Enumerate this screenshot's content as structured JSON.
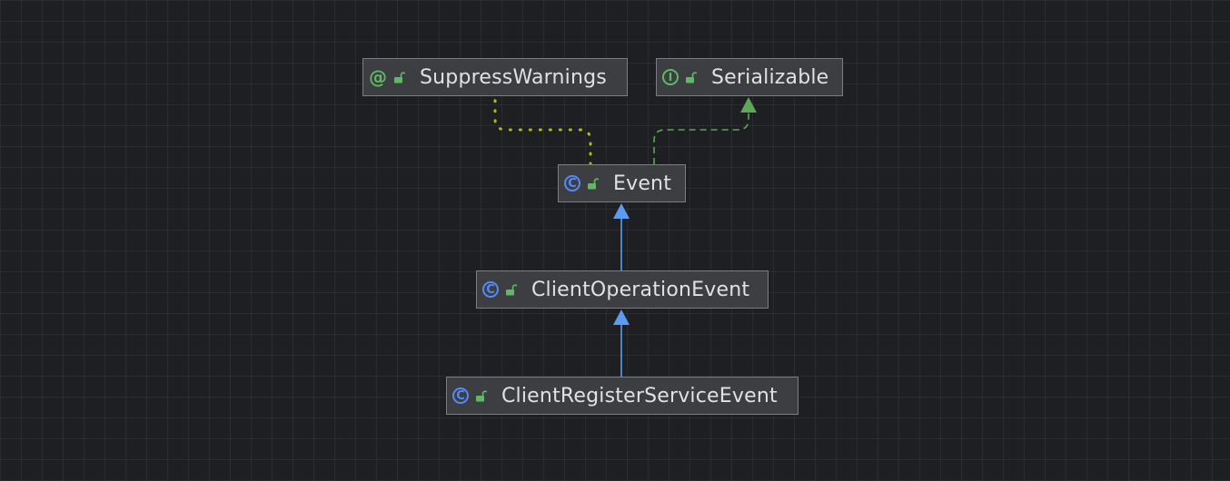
{
  "diagram": {
    "nodes": [
      {
        "id": "suppress",
        "label": "SuppressWarnings",
        "kind": "annotation",
        "icon": "annotation-icon",
        "kind_glyph": "@"
      },
      {
        "id": "serializable",
        "label": "Serializable",
        "kind": "interface",
        "icon": "interface-icon",
        "kind_glyph": "I"
      },
      {
        "id": "event",
        "label": "Event",
        "kind": "class",
        "icon": "class-icon",
        "kind_glyph": "C"
      },
      {
        "id": "clientop",
        "label": "ClientOperationEvent",
        "kind": "class",
        "icon": "class-icon",
        "kind_glyph": "C"
      },
      {
        "id": "clientreg",
        "label": "ClientRegisterServiceEvent",
        "kind": "class",
        "icon": "class-icon",
        "kind_glyph": "C"
      }
    ],
    "edges": [
      {
        "from": "event",
        "to": "suppress",
        "type": "annotated-by",
        "style": "dotted"
      },
      {
        "from": "event",
        "to": "serializable",
        "type": "implements",
        "style": "dashed"
      },
      {
        "from": "clientop",
        "to": "event",
        "type": "extends",
        "style": "solid"
      },
      {
        "from": "clientreg",
        "to": "clientop",
        "type": "extends",
        "style": "solid"
      }
    ],
    "colors": {
      "background": "#1e1f22",
      "node_fill": "#3c3e42",
      "node_border": "#7a7d83",
      "text": "#dfe1e5",
      "class_icon": "#548af7",
      "green_icon": "#5fb865",
      "extends_edge": "#5c9bf0",
      "implements_edge": "#5fa55a",
      "annotation_edge": "#b3b81a"
    }
  }
}
